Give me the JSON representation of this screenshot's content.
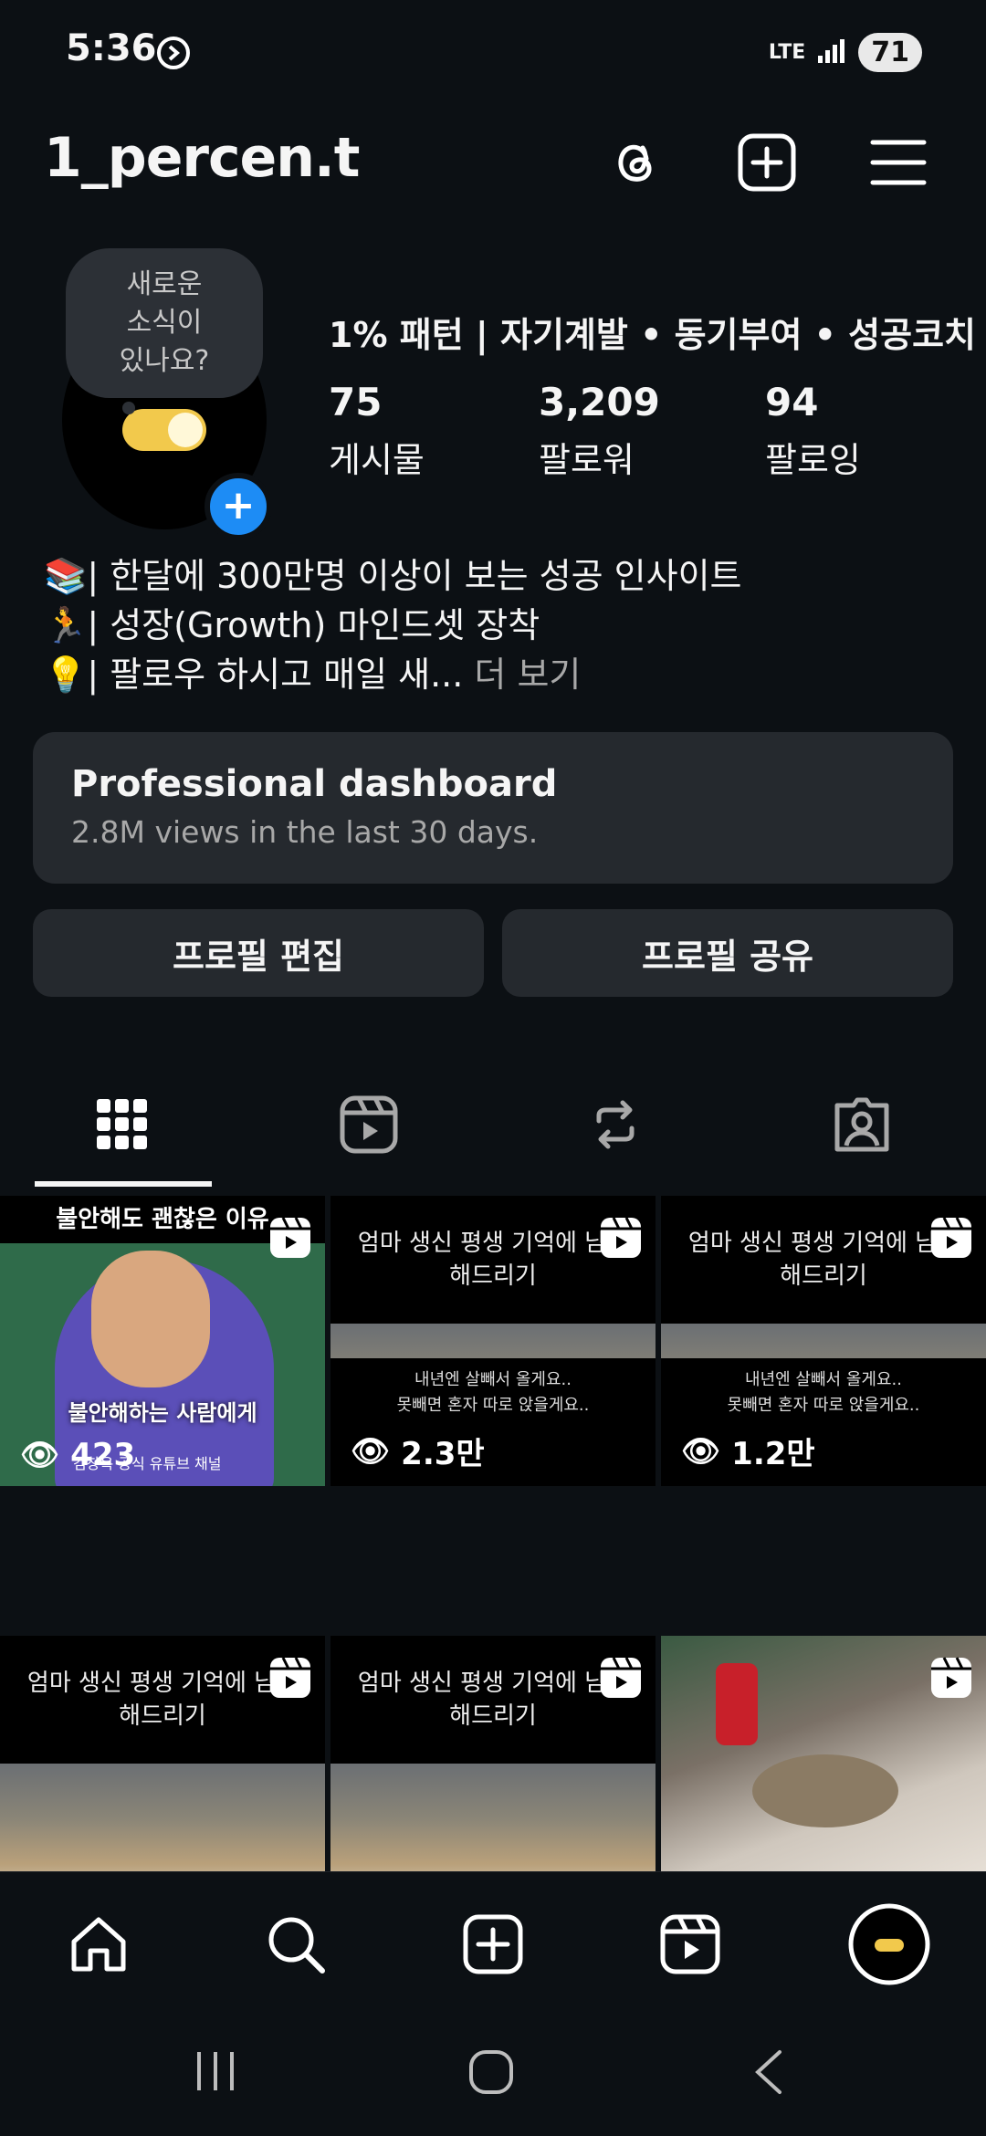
{
  "status": {
    "time": "5:36",
    "network": "LTE",
    "battery": "71"
  },
  "header": {
    "username": "1_percen.t"
  },
  "profile": {
    "note": "새로운\n소식이\n있나요?",
    "display_name": "1% 패턴 | 자기계발 • 동기부여 • 성공코치",
    "stats": [
      {
        "value": "75",
        "label": "게시물"
      },
      {
        "value": "3,209",
        "label": "팔로워"
      },
      {
        "value": "94",
        "label": "팔로잉"
      }
    ],
    "bio": [
      "📚| 한달에 300만명 이상이 보는 성공 인사이트",
      "🏃| 성장(Growth) 마인드셋 장착",
      "💡| 팔로우 하시고 매일 새..."
    ],
    "bio_more": "더 보기"
  },
  "dashboard": {
    "title": "Professional dashboard",
    "subtitle": "2.8M views in the last 30 days."
  },
  "buttons": {
    "edit": "프로필 편집",
    "share": "프로필 공유"
  },
  "grid": [
    {
      "top": "불안해도 괜찮은 이유",
      "mid": "불안해하는 사람에게",
      "bottom": "김창옥 공식 유튜브 채널",
      "views": "423"
    },
    {
      "top": "엄마 생신 평생 기억에 남게\n해드리기",
      "bottom": "내년엔 살빼서 올게요..\n못빼면 혼자 따로 앉을게요..",
      "views": "2.3만"
    },
    {
      "top": "엄마 생신 평생 기억에 남게\n해드리기",
      "bottom": "내년엔 살빼서 올게요..\n못빼면 혼자 따로 앉을게요..",
      "views": "1.2만"
    },
    {
      "top": "엄마 생신 평생 기억에 남게\n해드리기"
    },
    {
      "top": "엄마 생신 평생 기억에 남게\n해드리기"
    },
    {
      "top": ""
    }
  ],
  "colors": {
    "background": "#0c1014",
    "card": "#25292e",
    "accent": "#1d8cf5",
    "toggle": "#f2c94c"
  }
}
